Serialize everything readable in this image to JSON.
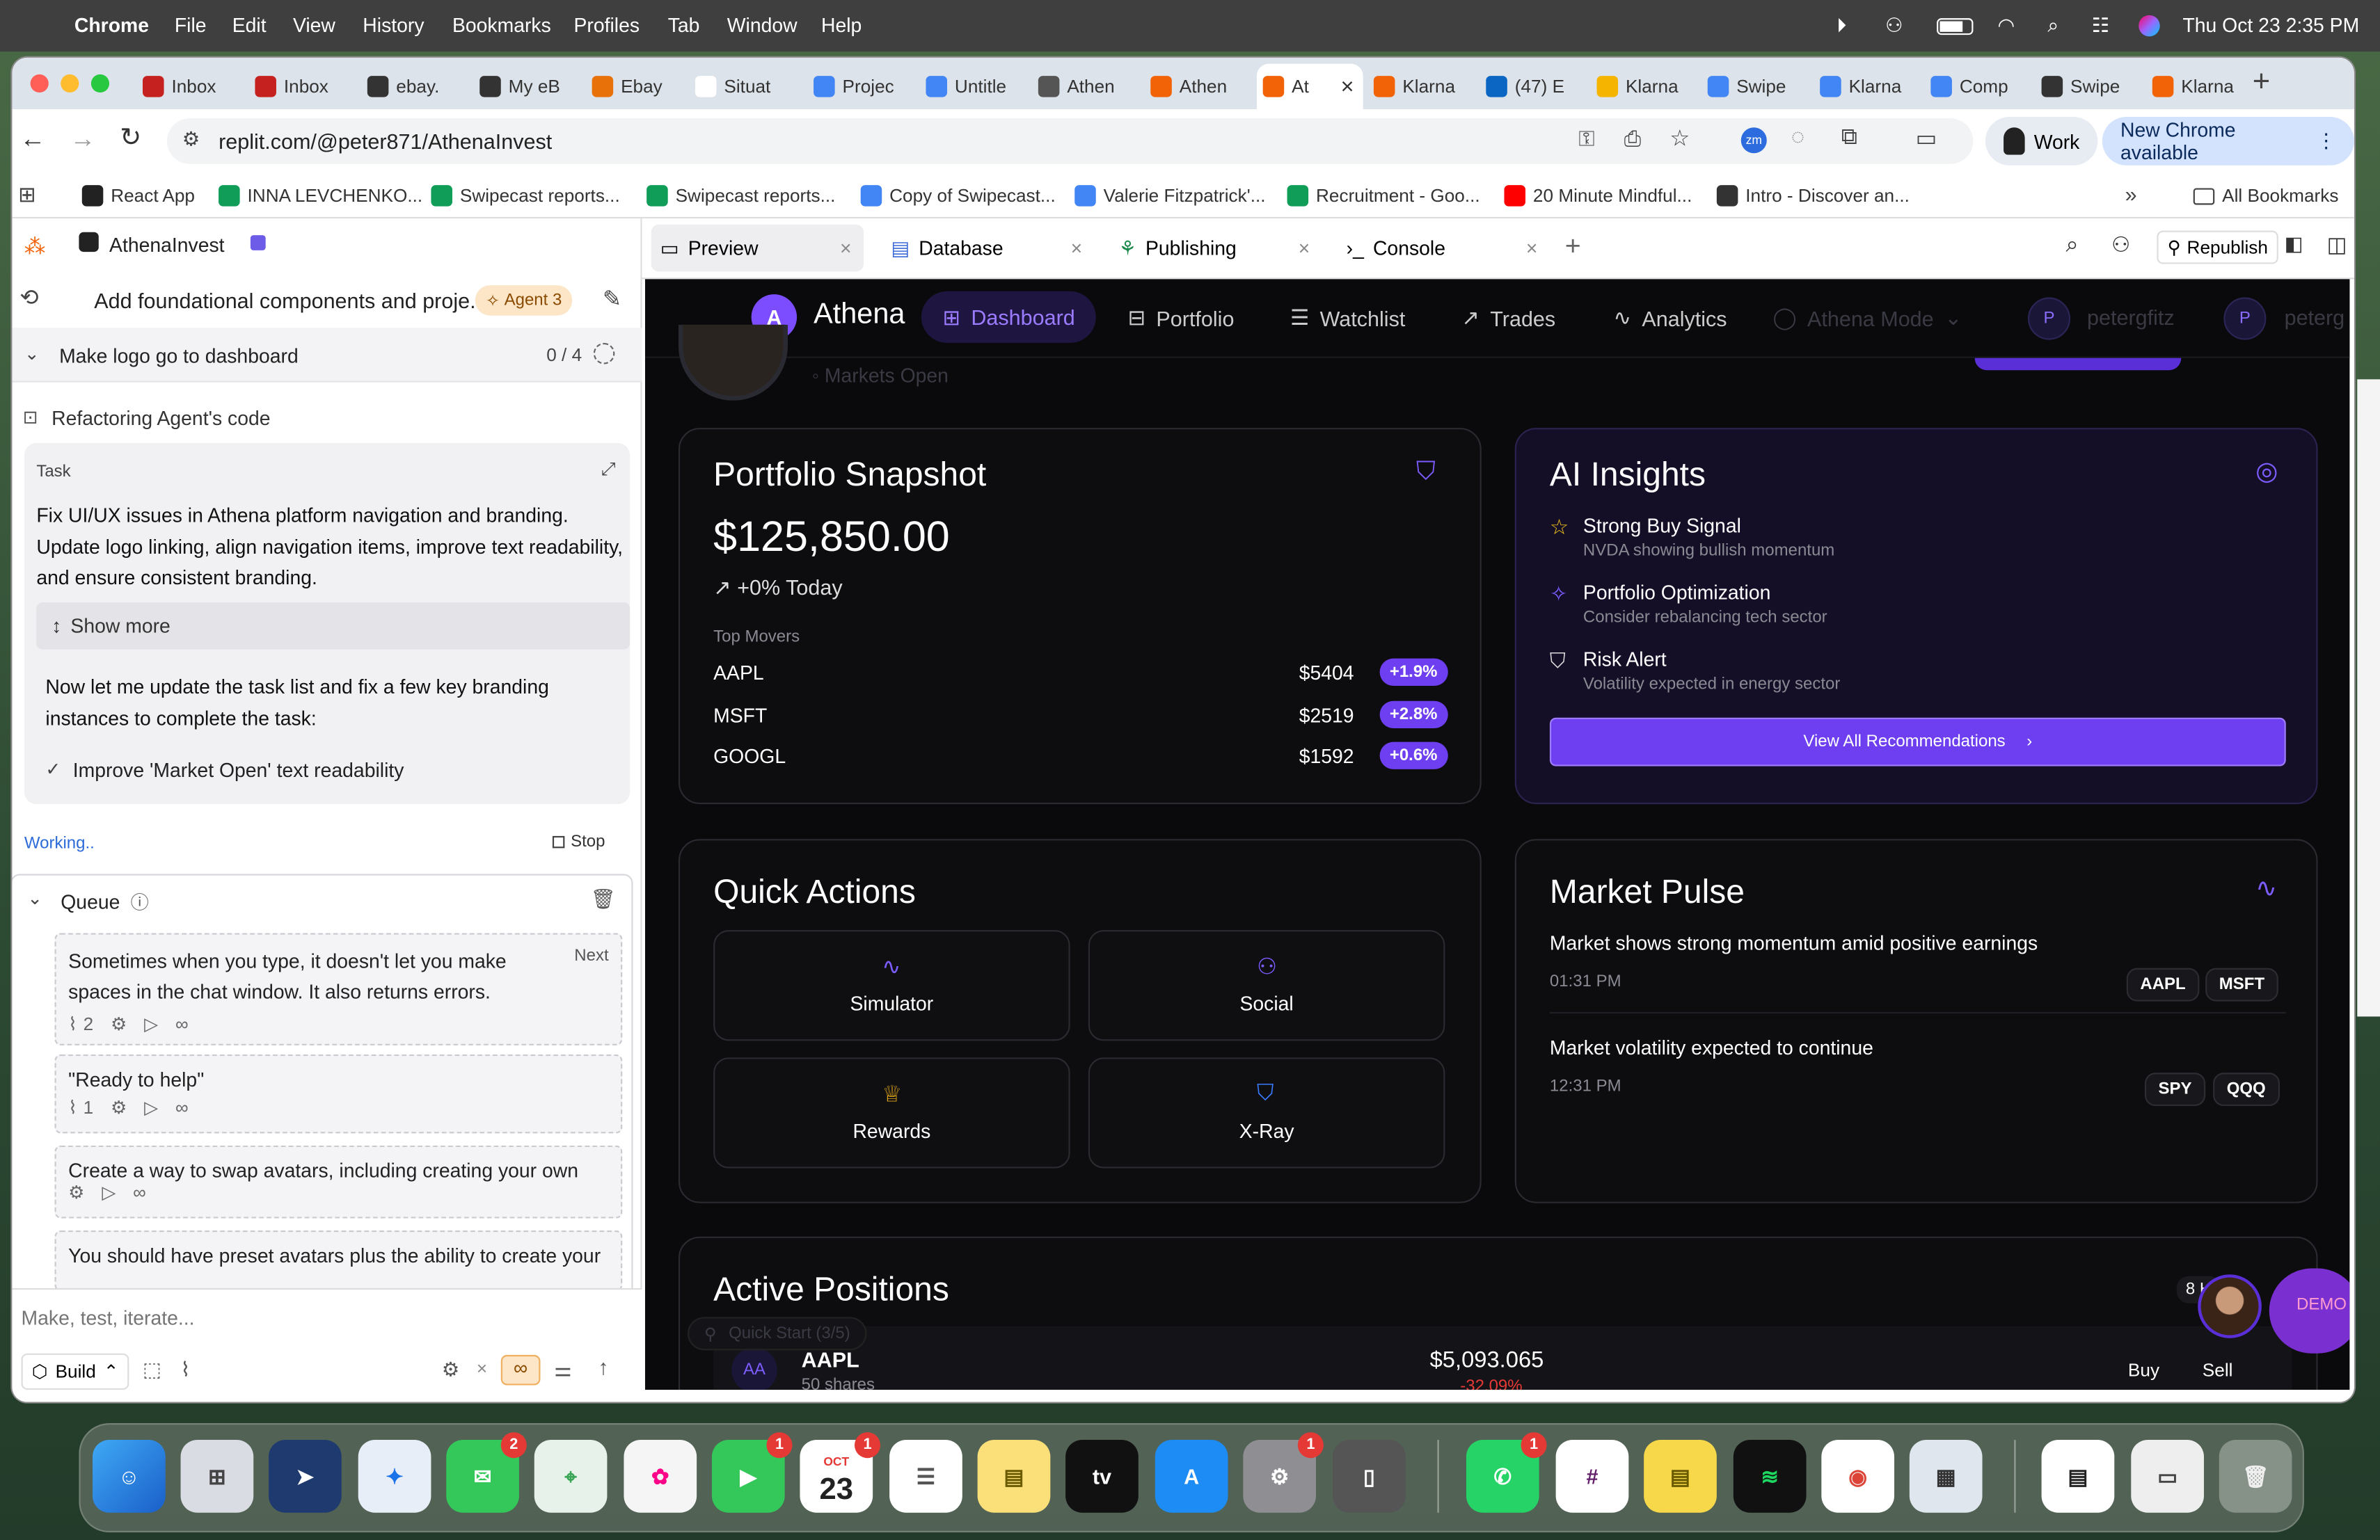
{
  "menubar": {
    "app": "Chrome",
    "items": [
      "File",
      "Edit",
      "View",
      "History",
      "Bookmarks",
      "Profiles",
      "Tab",
      "Window",
      "Help"
    ],
    "datetime": "Thu Oct 23  2:35 PM"
  },
  "tabs": [
    {
      "label": "Inbox",
      "color": "#c5221f"
    },
    {
      "label": "Inbox",
      "color": "#c5221f"
    },
    {
      "label": "ebay.",
      "color": "#333"
    },
    {
      "label": "My eB",
      "color": "#333"
    },
    {
      "label": "Ebay",
      "color": "#e8710a"
    },
    {
      "label": "Situat",
      "color": "#fff"
    },
    {
      "label": "Projec",
      "color": "#4285f4"
    },
    {
      "label": "Untitle",
      "color": "#4285f4"
    },
    {
      "label": "Athen",
      "color": "#555"
    },
    {
      "label": "Athen",
      "color": "#f26207"
    },
    {
      "label": "At",
      "color": "#f26207",
      "active": true
    },
    {
      "label": "Klarna",
      "color": "#f26207"
    },
    {
      "label": "(47) E",
      "color": "#0a66c2"
    },
    {
      "label": "Klarna",
      "color": "#f4b400"
    },
    {
      "label": "Swipe",
      "color": "#4285f4"
    },
    {
      "label": "Klarna",
      "color": "#4285f4"
    },
    {
      "label": "Comp",
      "color": "#4285f4"
    },
    {
      "label": "Swipe",
      "color": "#333"
    },
    {
      "label": "Klarna",
      "color": "#f26207"
    }
  ],
  "address": {
    "url": "replit.com/@peter871/AthenaInvest",
    "profile": "Work",
    "update": "New Chrome available"
  },
  "bookmarks": [
    {
      "label": "React App",
      "color": "#222"
    },
    {
      "label": "INNA LEVCHENKO...",
      "color": "#0f9d58"
    },
    {
      "label": "Swipecast reports...",
      "color": "#0f9d58"
    },
    {
      "label": "Swipecast reports...",
      "color": "#0f9d58"
    },
    {
      "label": "Copy of Swipecast...",
      "color": "#4285f4"
    },
    {
      "label": "Valerie Fitzpatrick'...",
      "color": "#4285f4"
    },
    {
      "label": "Recruitment - Goo...",
      "color": "#0f9d58"
    },
    {
      "label": "20 Minute Mindful...",
      "color": "#ff0000"
    },
    {
      "label": "Intro - Discover an...",
      "color": "#333"
    }
  ],
  "bookmarks_all": "All Bookmarks",
  "replit": {
    "project": "AthenaInvest",
    "thread_title": "Add foundational components and proje...",
    "agent_badge": "Agent 3",
    "checklist_title": "Make logo go to dashboard",
    "checklist_count": "0 / 4",
    "refactoring": "Refactoring Agent's code",
    "task_label": "Task",
    "task_text": "Fix UI/UX issues in Athena platform navigation and branding. Update logo linking, align navigation items, improve text readability, and ensure consistent branding.",
    "show_more": "Show more",
    "message": "Now let me update the task list and fix a few key branding instances to complete the task:",
    "done_item": "Improve 'Market Open' text readability",
    "working": "Working..",
    "stop": "Stop",
    "queue_label": "Queue",
    "queue": [
      {
        "text": "Sometimes when you type, it doesn't let you make spaces in the chat window. It also returns errors.",
        "count": "2",
        "next": "Next"
      },
      {
        "text": "\"Ready to help\"",
        "count": "1"
      },
      {
        "text": "Create a way to swap avatars, including creating your own"
      },
      {
        "text": "You should have preset avatars plus the ability to create your"
      }
    ],
    "input_placeholder": "Make, test, iterate...",
    "build": "Build"
  },
  "panel_tabs": [
    "Preview",
    "Database",
    "Publishing",
    "Console"
  ],
  "republish": "Republish",
  "app": {
    "brand": "Athena",
    "brand_initial": "A",
    "nav": [
      "Dashboard",
      "Portfolio",
      "Watchlist",
      "Trades",
      "Analytics"
    ],
    "mode": "Athena Mode",
    "user": "petergfitz",
    "user_initial": "P",
    "user_trunc": "peterg",
    "market_status": "Markets Open",
    "portfolio": {
      "title": "Portfolio Snapshot",
      "value": "$125,850.00",
      "change": "+0% Today",
      "movers_label": "Top Movers",
      "movers": [
        {
          "sym": "AAPL",
          "price": "$5404",
          "pct": "+1.9%"
        },
        {
          "sym": "MSFT",
          "price": "$2519",
          "pct": "+2.8%"
        },
        {
          "sym": "GOOGL",
          "price": "$1592",
          "pct": "+0.6%"
        }
      ]
    },
    "insights": {
      "title": "AI Insights",
      "items": [
        {
          "title": "Strong Buy Signal",
          "sub": "NVDA showing bullish momentum"
        },
        {
          "title": "Portfolio Optimization",
          "sub": "Consider rebalancing tech sector"
        },
        {
          "title": "Risk Alert",
          "sub": "Volatility expected in energy sector"
        }
      ],
      "button": "View All Recommendations"
    },
    "quick": {
      "title": "Quick Actions",
      "items": [
        "Simulator",
        "Social",
        "Rewards",
        "X-Ray"
      ]
    },
    "pulse": {
      "title": "Market Pulse",
      "items": [
        {
          "headline": "Market shows strong momentum amid positive earnings",
          "time": "01:31 PM",
          "tags": [
            "AAPL",
            "MSFT"
          ]
        },
        {
          "headline": "Market volatility expected to continue",
          "time": "12:31 PM",
          "tags": [
            "SPY",
            "QQQ"
          ]
        }
      ]
    },
    "positions": {
      "title": "Active Positions",
      "count": "8 H",
      "row": {
        "initials": "AA",
        "sym": "AAPL",
        "shares": "50 shares",
        "value": "$5,093.065",
        "pct": "-32.09%",
        "buy": "Buy",
        "sell": "Sell"
      },
      "quickstart": "Quick Start (3/5)",
      "demo": "DEMO"
    }
  },
  "dock": {
    "calendar_month": "OCT",
    "calendar_day": "23",
    "badges": {
      "messages": "2",
      "facetime": "1",
      "settings": "1",
      "whatsapp": "1",
      "calendar2": "1"
    }
  }
}
